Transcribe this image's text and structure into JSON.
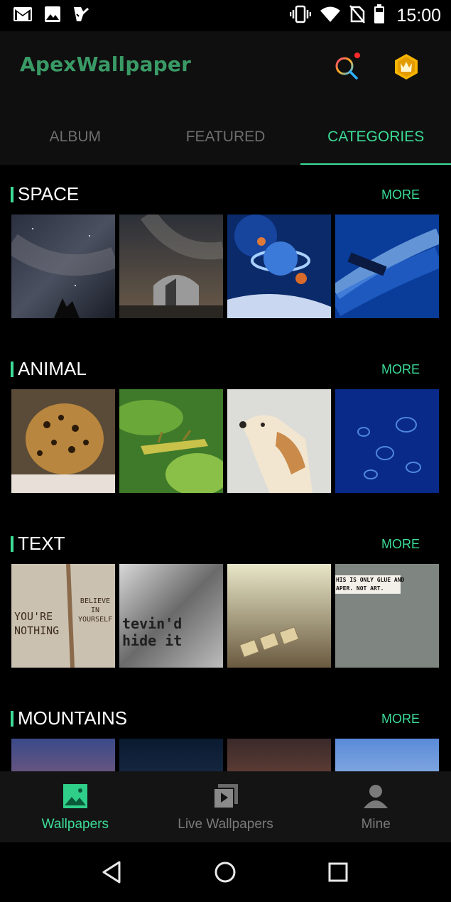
{
  "status_bar": {
    "left_icons": [
      "gmail-icon",
      "image-icon",
      "check-flag-icon"
    ],
    "right_icons": [
      "vibrate-icon",
      "wifi-icon",
      "no-sim-icon",
      "battery-icon"
    ],
    "time": "15:00"
  },
  "app_bar": {
    "brand": "ApexWallpaper",
    "actions": [
      "search-icon",
      "crown-badge-icon"
    ]
  },
  "tabs": [
    {
      "label": "ALBUM",
      "active": false
    },
    {
      "label": "FEATURED",
      "active": false
    },
    {
      "label": "CATEGORIES",
      "active": true
    }
  ],
  "sections": [
    {
      "title": "SPACE",
      "more": "MORE",
      "thumbnails": [
        "milky-way-sky",
        "observatory-night",
        "planets-space",
        "blue-nebula"
      ]
    },
    {
      "title": "ANIMAL",
      "more": "MORE",
      "thumbnails": [
        "leopard",
        "grasshoppers-leaves",
        "labrador-dog",
        "blue-jellyfish"
      ]
    },
    {
      "title": "TEXT",
      "more": "MORE",
      "thumbnails": [
        "burlap-text",
        "glass-mirror-text",
        "scrabble-tiles",
        "wall-sticker"
      ],
      "captions": {
        "burlap_left": "YOU'RE NOTHING",
        "burlap_right": "BELIEVE IN YOURSELF",
        "mirror": "tevin'd hide it",
        "sticker_1": "HIS IS ONLY GLUE AND",
        "sticker_2": "APER. NOT ART."
      }
    },
    {
      "title": "MOUNTAINS",
      "more": "MORE",
      "thumbnails": [
        "dusk-sky",
        "night-sky",
        "sunset-clouds",
        "pale-sky"
      ]
    }
  ],
  "bottom_nav": [
    {
      "label": "Wallpapers",
      "icon": "image-icon",
      "active": true
    },
    {
      "label": "Live Wallpapers",
      "icon": "live-wallpaper-icon",
      "active": false
    },
    {
      "label": "Mine",
      "icon": "person-icon",
      "active": false
    }
  ],
  "system_nav": [
    "back-icon",
    "home-icon",
    "recents-icon"
  ],
  "colors": {
    "accent": "#3ddc97",
    "brand": "#3a9a66",
    "inactive": "#6e6e6e",
    "bar_bg": "#0f0f0f"
  }
}
